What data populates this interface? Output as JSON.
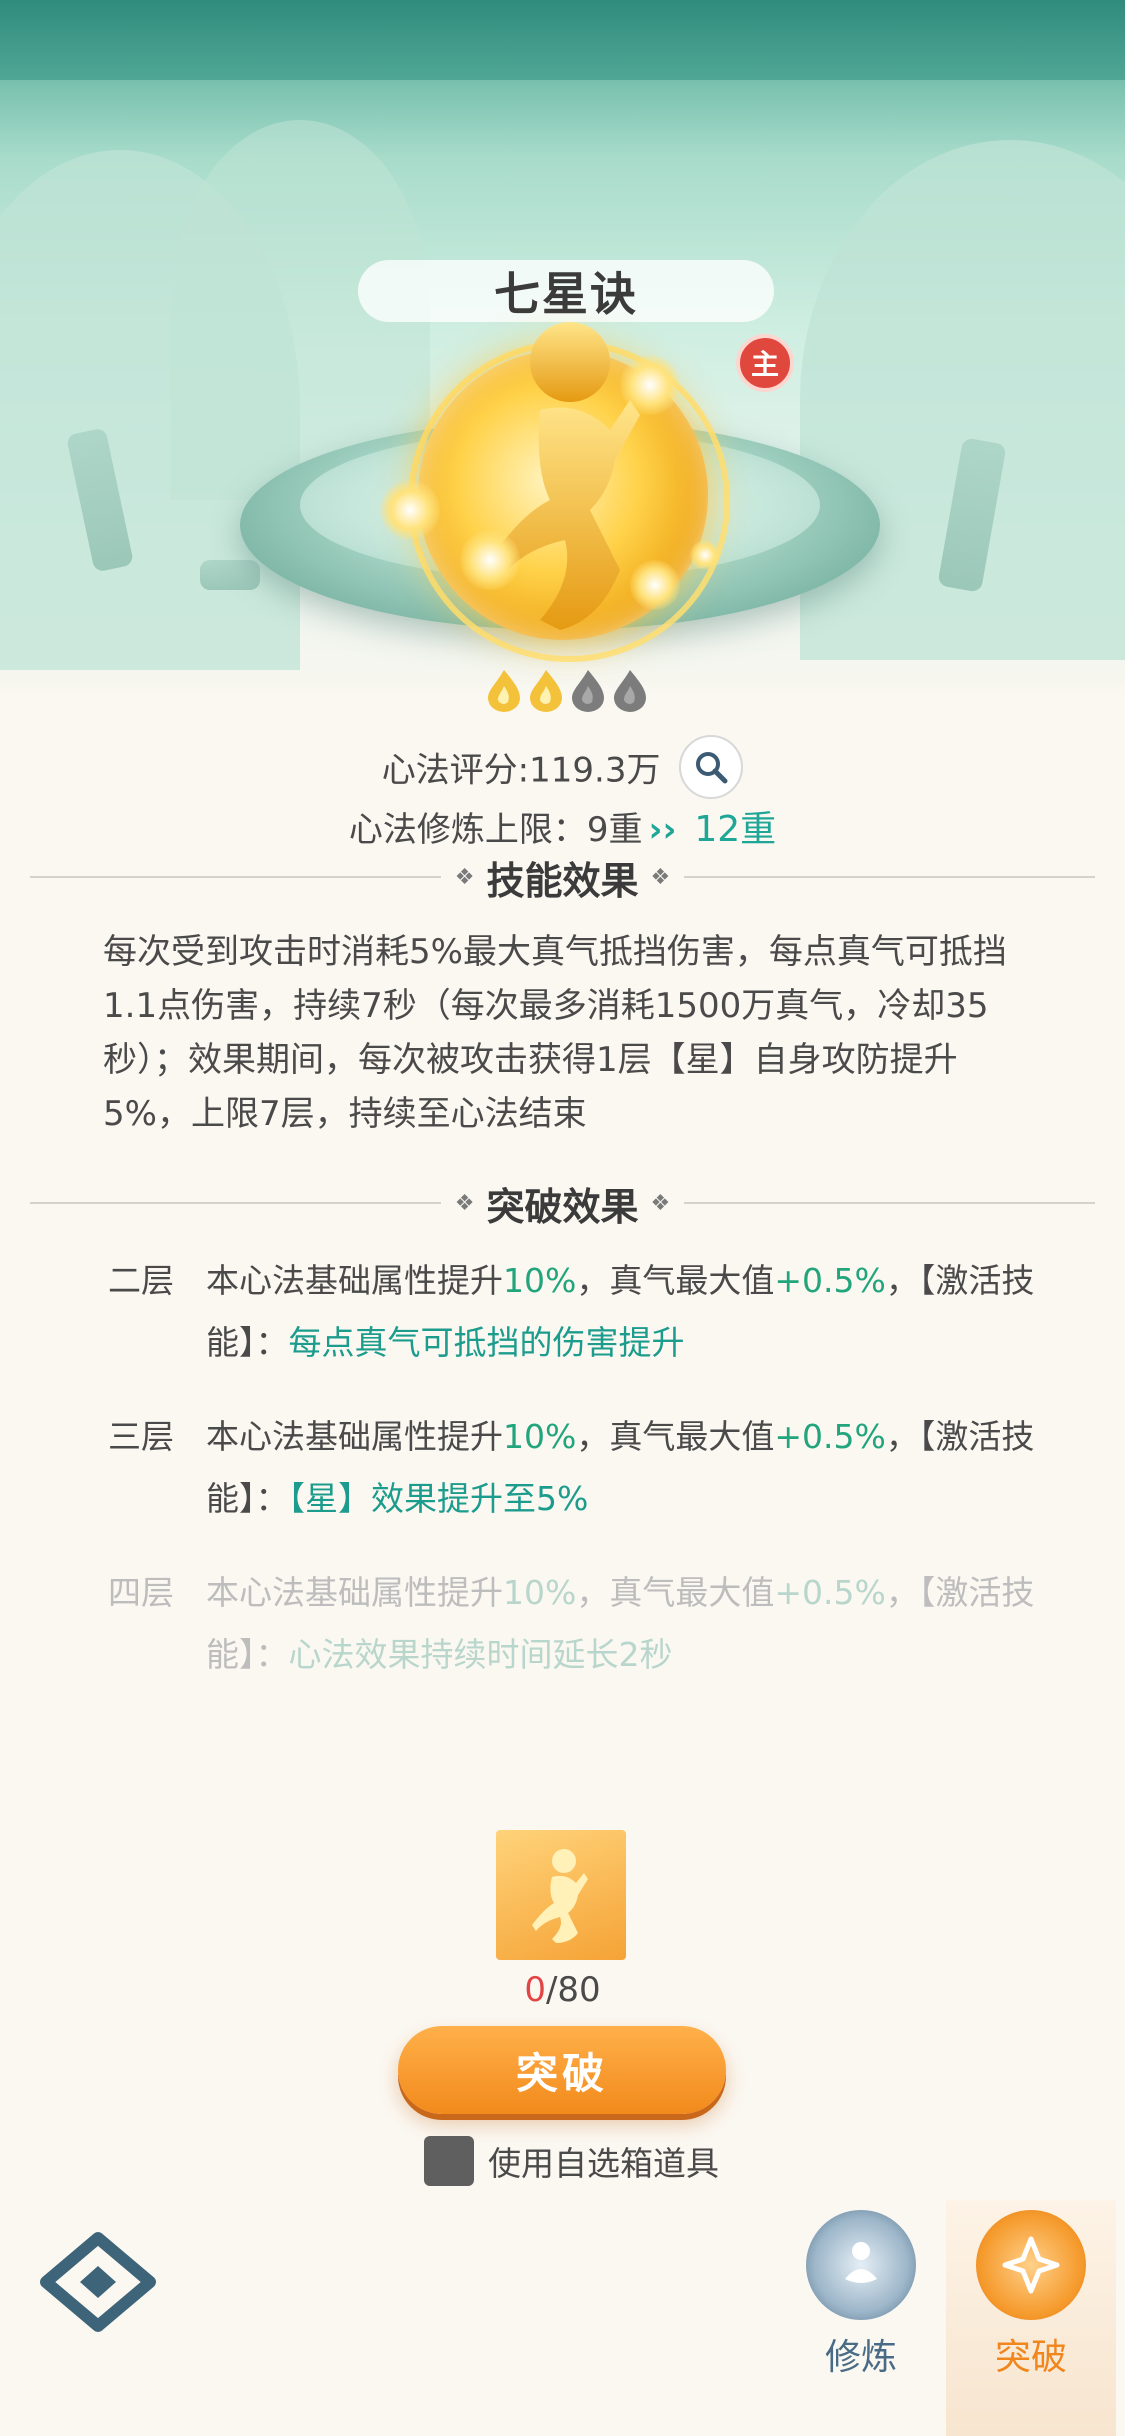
{
  "header": {
    "title": "七星诀",
    "main_badge": "主"
  },
  "rating": {
    "filled": 2,
    "total": 4
  },
  "score": {
    "label": "心法评分:119.3万"
  },
  "limit": {
    "label": "心法修炼上限：",
    "current": "9重",
    "next": "12重"
  },
  "skill": {
    "title": "技能效果",
    "description": "每次受到攻击时消耗5%最大真气抵挡伤害，每点真气可抵挡1.1点伤害，持续7秒（每次最多消耗1500万真气，冷却35秒）；效果期间，每次被攻击获得1层【星】自身攻防提升5%，上限7层，持续至心法结束"
  },
  "breakthrough": {
    "title": "突破效果",
    "levels": [
      {
        "level": "二层",
        "p1": "本心法基础属性提升",
        "v1": "10%",
        "p2": "，真气最大值",
        "v2": "+0.5%",
        "p3": "，【激活技能】：",
        "effect": "每点真气可抵挡的伤害提升"
      },
      {
        "level": "三层",
        "p1": "本心法基础属性提升",
        "v1": "10%",
        "p2": "，真气最大值",
        "v2": "+0.5%",
        "p3": "，【激活技能】：",
        "effect": "【星】效果提升至5%"
      },
      {
        "level": "四层",
        "p1": "本心法基础属性提升",
        "v1": "10%",
        "p2": "，真气最大值",
        "v2": "+0.5%",
        "p3": "，【激活技能】：",
        "effect": "心法效果持续时间延长2秒"
      }
    ]
  },
  "material": {
    "have": "0",
    "need": "/80"
  },
  "button": {
    "label": "突破"
  },
  "checkbox": {
    "label": "使用自选箱道具"
  },
  "tabs": [
    {
      "label": "修炼",
      "color": "#4a6b86"
    },
    {
      "label": "突破",
      "color": "#f0861c"
    }
  ]
}
